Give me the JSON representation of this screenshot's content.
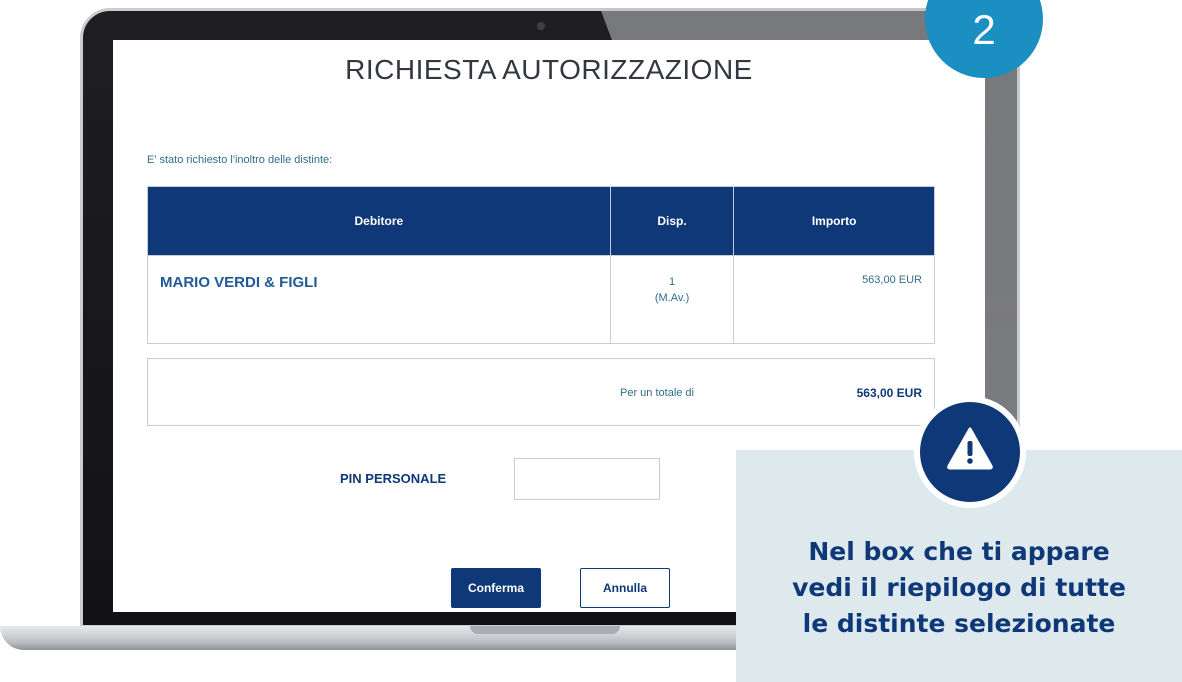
{
  "dialog": {
    "title": "RICHIESTA AUTORIZZAZIONE",
    "intro": "E' stato richiesto l'inoltro delle distinte:",
    "table": {
      "headers": [
        "Debitore",
        "Disp.",
        "Importo"
      ],
      "rows": [
        {
          "debitore": "MARIO VERDI &  FIGLI",
          "disp_count": "1",
          "disp_type": "(M.Av.)",
          "importo": "563,00 EUR"
        }
      ]
    },
    "total_label": "Per un totale di",
    "total_value": "563,00 EUR",
    "pin_label": "PIN PERSONALE",
    "pin_value": "",
    "confirm_label": "Conferma",
    "cancel_label": "Annulla"
  },
  "step": {
    "number": "2"
  },
  "callout": {
    "line1": "Nel box che ti appare",
    "line2": "vedi il riepilogo di tutte",
    "line3": "le distinte selezionate",
    "icon": "warning-icon"
  },
  "colors": {
    "navy": "#0f3878",
    "step_blue": "#1b8ec2",
    "callout_bg": "#dde9ed",
    "text_teal": "#2f6f8a"
  }
}
